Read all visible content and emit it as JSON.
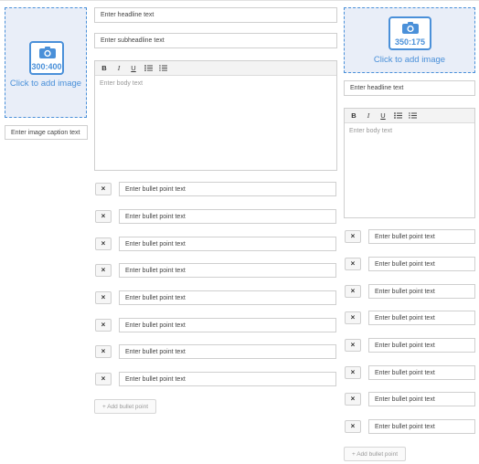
{
  "left_column": {
    "image": {
      "ratio": "300:400",
      "click_label": "Click to add image",
      "icon": "camera-icon"
    },
    "caption_placeholder": "Enter image caption text"
  },
  "middle_column": {
    "headline_placeholder": "Enter headline text",
    "subheadline_placeholder": "Enter subheadline text",
    "body_placeholder": "Enter body text",
    "toolbar": {
      "bold": "B",
      "italic": "I",
      "underline": "U"
    },
    "bullets": [
      "Enter bullet point text",
      "Enter bullet point text",
      "Enter bullet point text",
      "Enter bullet point text",
      "Enter bullet point text",
      "Enter bullet point text",
      "Enter bullet point text",
      "Enter bullet point text"
    ],
    "remove_label": "×",
    "add_bullet_label": "+ Add bullet point"
  },
  "right_column": {
    "image": {
      "ratio": "350:175",
      "click_label": "Click to add image",
      "icon": "camera-icon"
    },
    "headline_placeholder": "Enter headline text",
    "body_placeholder": "Enter body text",
    "toolbar": {
      "bold": "B",
      "italic": "I",
      "underline": "U"
    },
    "bullets": [
      "Enter bullet point text",
      "Enter bullet point text",
      "Enter bullet point text",
      "Enter bullet point text",
      "Enter bullet point text",
      "Enter bullet point text",
      "Enter bullet point text",
      "Enter bullet point text"
    ],
    "remove_label": "×",
    "add_bullet_label": "+ Add bullet point"
  },
  "colors": {
    "accent": "#4a90d9",
    "drop_bg": "#e9eef8",
    "border": "#cfcfcf"
  }
}
